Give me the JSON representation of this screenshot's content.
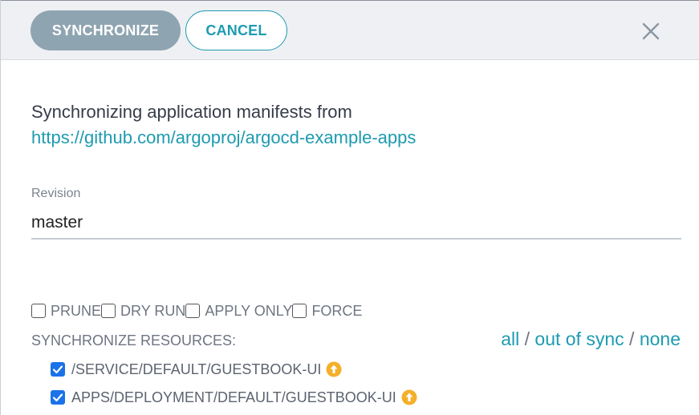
{
  "header": {
    "synchronize_label": "SYNCHRONIZE",
    "cancel_label": "CANCEL",
    "close_icon": "close-icon"
  },
  "message": {
    "text": "Synchronizing application manifests from",
    "repo_url": "https://github.com/argoproj/argocd-example-apps"
  },
  "revision": {
    "label": "Revision",
    "value": "master"
  },
  "options": [
    {
      "label": "PRUNE",
      "checked": false
    },
    {
      "label": "DRY RUN",
      "checked": false
    },
    {
      "label": "APPLY ONLY",
      "checked": false
    },
    {
      "label": "FORCE",
      "checked": false
    }
  ],
  "resources": {
    "heading": "SYNCHRONIZE RESOURCES:",
    "select_all": "all",
    "select_out_of_sync": "out of sync",
    "select_none": "none",
    "separator": "/",
    "items": [
      {
        "name": "/SERVICE/DEFAULT/GUESTBOOK-UI",
        "checked": true,
        "status_icon": "out-of-sync-arrow-icon"
      },
      {
        "name": "APPS/DEPLOYMENT/DEFAULT/GUESTBOOK-UI",
        "checked": true,
        "status_icon": "out-of-sync-arrow-icon"
      }
    ]
  },
  "colors": {
    "accent": "#1e9bb0",
    "sync_button": "#8fa4b1",
    "checkbox_checked": "#1a73e8",
    "status_icon": "#f4b02a"
  }
}
